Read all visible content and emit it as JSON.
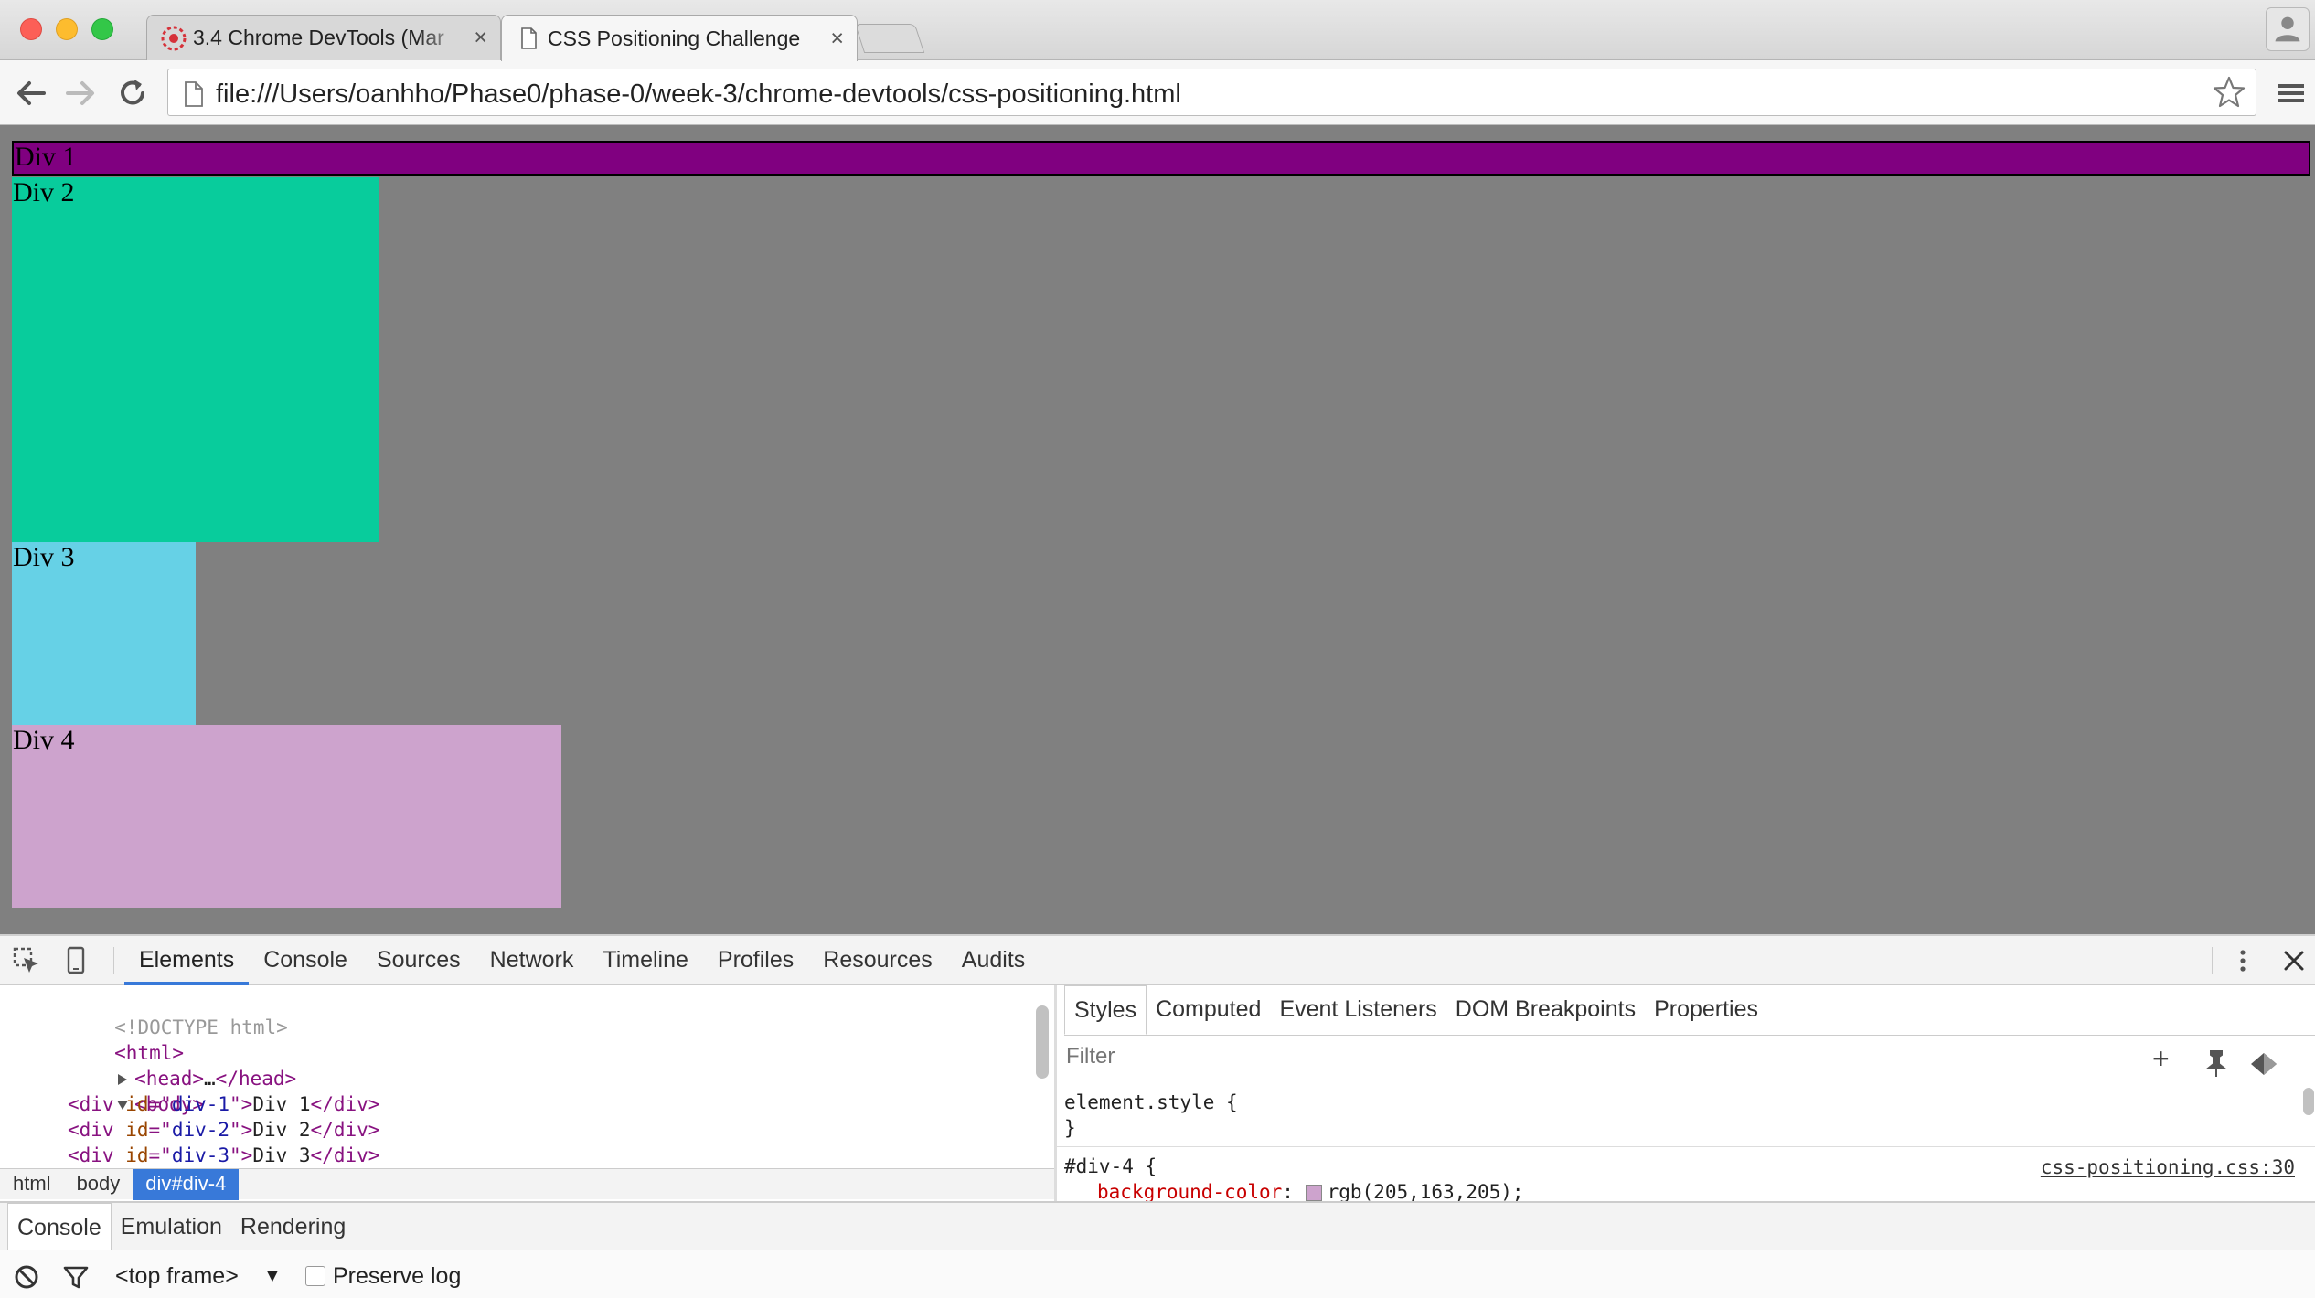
{
  "tabs": [
    {
      "title": "3.4 Chrome DevTools (Mar",
      "close": "×"
    },
    {
      "title": "CSS Positioning Challenge",
      "close": "×"
    }
  ],
  "address": {
    "url": "file:///Users/oanhho/Phase0/phase-0/week-3/chrome-devtools/css-positioning.html"
  },
  "page": {
    "divs": [
      {
        "label": "Div 1",
        "color": "#800080"
      },
      {
        "label": "Div 2",
        "color": "#08cc9c"
      },
      {
        "label": "Div 3",
        "color": "#66d1e6"
      },
      {
        "label": "Div 4",
        "color": "#cda3cd"
      }
    ],
    "background": "#808080"
  },
  "devtools": {
    "tabs": [
      "Elements",
      "Console",
      "Sources",
      "Network",
      "Timeline",
      "Profiles",
      "Resources",
      "Audits"
    ],
    "active_tab": "Elements",
    "dom": {
      "doctype": "<!DOCTYPE html>",
      "html_open": "<html>",
      "head_open": "<head>",
      "head_ellipsis": "…",
      "head_close": "</head>",
      "body_open": "<body>",
      "div_open_pre": "<div ",
      "id_attr": "id",
      "eq_quote": "=\"",
      "quote_gt": "\">",
      "div_close": "</div>",
      "rows": [
        {
          "id": "div-1",
          "text": "Div 1"
        },
        {
          "id": "div-2",
          "text": "Div 2"
        },
        {
          "id": "div-3",
          "text": "Div 3"
        }
      ]
    },
    "breadcrumbs": [
      "html",
      "body",
      "div#div-4"
    ],
    "styles": {
      "tabs": [
        "Styles",
        "Computed",
        "Event Listeners",
        "DOM Breakpoints",
        "Properties"
      ],
      "filter_placeholder": "Filter",
      "element_style_selector": "element.style {",
      "element_style_close": "}",
      "rule_selector": "#div-4 {",
      "rule_source": "css-positioning.css:30",
      "rule_prop": "background-color",
      "rule_colon": ":",
      "rule_value": "rgb(205,163,205);",
      "add_label": "+"
    },
    "drawer": {
      "tabs": [
        "Console",
        "Emulation",
        "Rendering"
      ],
      "frame": "<top frame>",
      "frame_arrow": "▼",
      "preserve_log": "Preserve log"
    }
  }
}
